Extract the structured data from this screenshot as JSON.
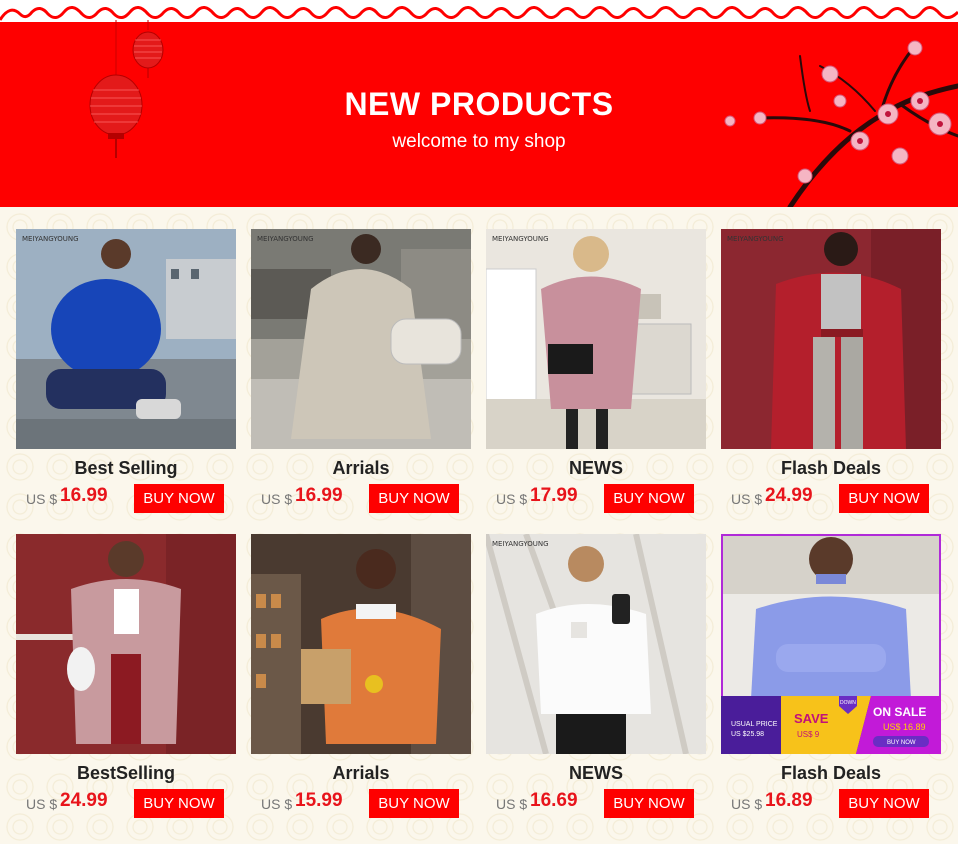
{
  "banner": {
    "title": "NEW PRODUCTS",
    "subtitle": "welcome to my shop"
  },
  "brand": "MEIYANGYOUNG",
  "products": [
    {
      "name": "Best Selling",
      "currency": "US $",
      "price": "16.99",
      "button": "BUY NOW"
    },
    {
      "name": "Arrials",
      "currency": "US $",
      "price": "16.99",
      "button": "BUY NOW"
    },
    {
      "name": "NEWS",
      "currency": "US $",
      "price": "17.99",
      "button": "BUY NOW"
    },
    {
      "name": "Flash Deals",
      "currency": "US $",
      "price": "24.99",
      "button": "BUY NOW"
    },
    {
      "name": "BestSelling",
      "currency": "US $",
      "price": "24.99",
      "button": "BUY NOW"
    },
    {
      "name": "Arrials",
      "currency": "US $",
      "price": "15.99",
      "button": "BUY NOW"
    },
    {
      "name": "NEWS",
      "currency": "US $",
      "price": "16.69",
      "button": "BUY NOW"
    },
    {
      "name": "Flash Deals",
      "currency": "US $",
      "price": "16.89",
      "button": "BUY NOW"
    }
  ],
  "sale_badge": {
    "usual_label": "USUAL PRICE",
    "usual_price": "US $25.98",
    "save_label": "SAVE",
    "save_amount": "US$ 9",
    "down_label": "DOWN",
    "on_sale": "ON SALE",
    "sale_price": "US$ 16.89",
    "buy_now": "BUY NOW"
  },
  "colors": {
    "banner_red": "#fe0000",
    "price_red": "#e8141b",
    "button_red": "#fe0000",
    "background": "#fbf8ef"
  }
}
